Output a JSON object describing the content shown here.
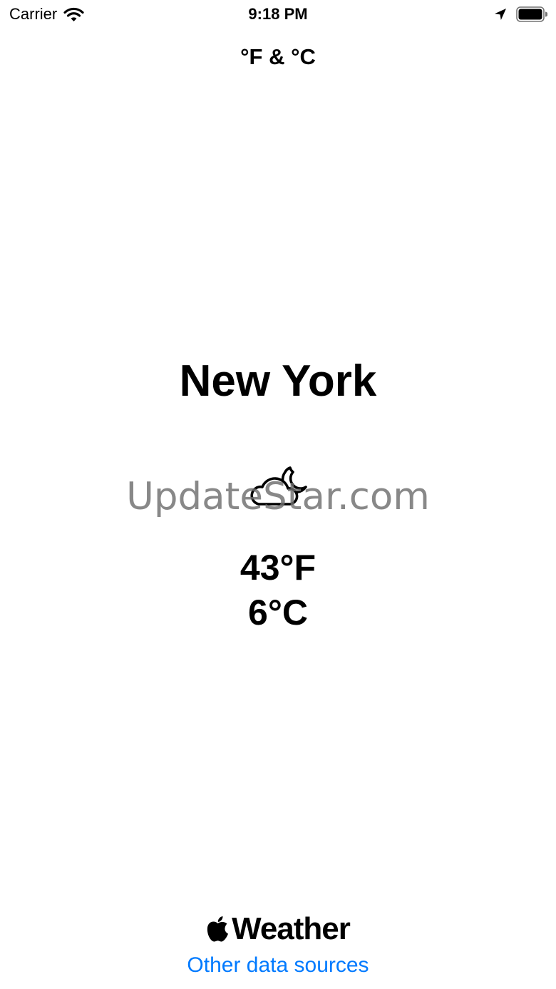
{
  "status_bar": {
    "carrier": "Carrier",
    "time": "9:18 PM",
    "wifi_icon": "wifi-icon",
    "location_icon": "location-arrow-icon",
    "battery_icon": "battery-full-icon"
  },
  "header": {
    "unit_toggle_label": "°F & °C"
  },
  "weather": {
    "city": "New York",
    "condition_icon": "cloud-moon-icon",
    "temperature_f": "43°F",
    "temperature_c": "6°C"
  },
  "watermark": {
    "text": "UpdateStar.com"
  },
  "footer": {
    "attribution_logo": "apple-logo-icon",
    "attribution_text": "Weather",
    "other_sources_label": "Other data sources"
  },
  "colors": {
    "background": "#ffffff",
    "text": "#000000",
    "link": "#007aff"
  }
}
